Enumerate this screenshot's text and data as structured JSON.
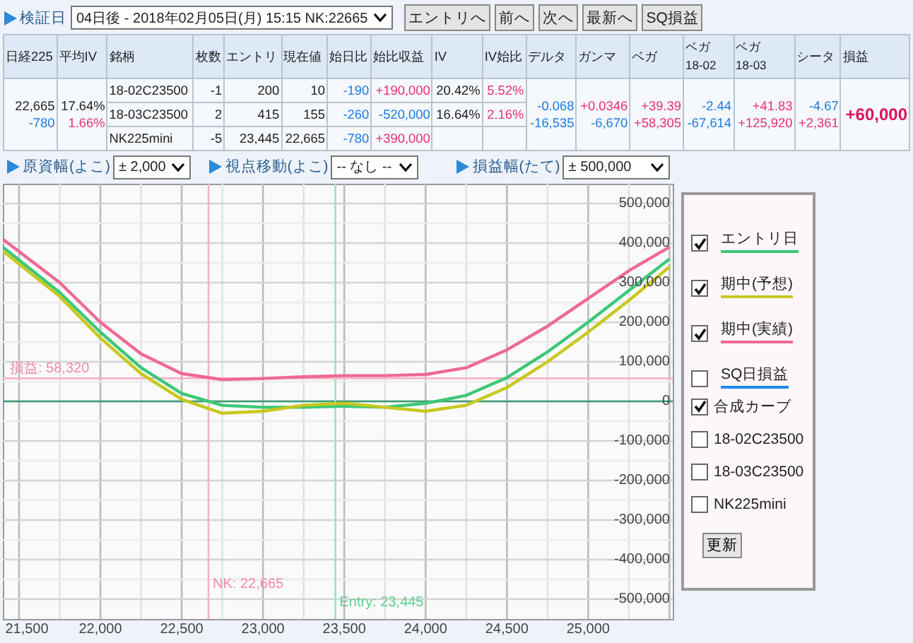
{
  "toolbar": {
    "label": "検証日",
    "date_select": "04日後 - 2018年02月05日(月) 15:15 NK:22665",
    "buttons": [
      "エントリへ",
      "前へ",
      "次へ",
      "最新へ",
      "SQ損益"
    ]
  },
  "table": {
    "columns": [
      {
        "label": "日経225"
      },
      {
        "label": "平均IV"
      },
      {
        "label": "銘柄"
      },
      {
        "label": "枚数"
      },
      {
        "label": "エントリ"
      },
      {
        "label": "現在値"
      },
      {
        "label": "始日比"
      },
      {
        "label": "始比収益"
      },
      {
        "label": "IV"
      },
      {
        "label": "IV始比"
      },
      {
        "label": "デルタ"
      },
      {
        "label": "ガンマ"
      },
      {
        "label": "ベガ"
      },
      {
        "label": "ベガ",
        "sub": "18-02"
      },
      {
        "label": "ベガ",
        "sub": "18-03"
      },
      {
        "label": "シータ"
      },
      {
        "label": "損益"
      }
    ],
    "nikkei": {
      "price": "22,665",
      "change": {
        "text": "-780",
        "color": "#1e7be6"
      }
    },
    "avg_iv": {
      "value": "17.64%",
      "change": {
        "text": "1.66%",
        "color": "#e8307a"
      }
    },
    "rows": [
      {
        "name": "18-02C23500",
        "qty": "-1",
        "entry": "200",
        "current": "10",
        "change": {
          "text": "-190",
          "color": "#1e7be6"
        },
        "pnl": {
          "text": "+190,000",
          "color": "#e8307a"
        },
        "iv": "20.42%",
        "iv_change": {
          "text": "5.52%",
          "color": "#e8307a"
        }
      },
      {
        "name": "18-03C23500",
        "qty": "2",
        "entry": "415",
        "current": "155",
        "change": {
          "text": "-260",
          "color": "#1e7be6"
        },
        "pnl": {
          "text": "-520,000",
          "color": "#1e7be6"
        },
        "iv": "16.64%",
        "iv_change": {
          "text": "2.16%",
          "color": "#e8307a"
        }
      },
      {
        "name": "NK225mini",
        "qty": "-5",
        "entry": "23,445",
        "current": "22,665",
        "change": {
          "text": "-780",
          "color": "#1e7be6"
        },
        "pnl": {
          "text": "+390,000",
          "color": "#e8307a"
        }
      }
    ],
    "greeks": [
      {
        "values": [
          {
            "text": "-0.068",
            "color": "#1e7be6"
          },
          {
            "text": "-16,535",
            "color": "#1e7be6"
          }
        ]
      },
      {
        "values": [
          {
            "text": "+0.0346",
            "color": "#e8307a"
          },
          {
            "text": "-6,670",
            "color": "#1e7be6"
          }
        ]
      },
      {
        "values": [
          {
            "text": "+39.39",
            "color": "#e8307a"
          },
          {
            "text": "+58,305",
            "color": "#e8307a"
          }
        ]
      },
      {
        "values": [
          {
            "text": "-2.44",
            "color": "#1e7be6"
          },
          {
            "text": "-67,614",
            "color": "#1e7be6"
          }
        ]
      },
      {
        "values": [
          {
            "text": "+41.83",
            "color": "#e8307a"
          },
          {
            "text": "+125,920",
            "color": "#e8307a"
          }
        ]
      },
      {
        "values": [
          {
            "text": "-4.67",
            "color": "#1e7be6"
          },
          {
            "text": "+2,361",
            "color": "#e8307a"
          }
        ]
      }
    ],
    "total_pnl": {
      "text": "+60,000",
      "color": "#e0105a"
    }
  },
  "controls": [
    {
      "label": "原資幅(よこ)",
      "value": "± 2,000"
    },
    {
      "label": "視点移動(よこ)",
      "value": "-- なし --"
    },
    {
      "label": "損益幅(たて)",
      "value": "± 500,000"
    }
  ],
  "chart": {
    "chart_data": {
      "type": "line",
      "x": [
        21400,
        21750,
        22000,
        22250,
        22500,
        22750,
        23000,
        23250,
        23500,
        23750,
        24000,
        24250,
        24500,
        24750,
        25000,
        25250,
        25500
      ],
      "series": [
        {
          "color": "#3cc878",
          "values": [
            390000,
            275000,
            175000,
            85000,
            20000,
            -10000,
            -15000,
            -15000,
            -12000,
            -15000,
            -5000,
            15000,
            60000,
            125000,
            200000,
            280000,
            360000
          ]
        },
        {
          "color": "#c8c81e",
          "values": [
            380000,
            265000,
            160000,
            70000,
            5000,
            -30000,
            -25000,
            -10000,
            -5000,
            -15000,
            -25000,
            -10000,
            35000,
            100000,
            175000,
            255000,
            340000
          ]
        },
        {
          "color": "#ee6a93",
          "values": [
            410000,
            300000,
            200000,
            120000,
            70000,
            55000,
            58000,
            62000,
            65000,
            65000,
            68000,
            85000,
            130000,
            190000,
            260000,
            330000,
            390000
          ]
        }
      ],
      "xlim": [
        21400,
        25520
      ],
      "ylim": [
        -550000,
        550000
      ],
      "grid": true,
      "xticks": [
        {
          "value": 21500,
          "label": "21,500"
        },
        {
          "value": 22000,
          "label": "22,000"
        },
        {
          "value": 22500,
          "label": "22,500"
        },
        {
          "value": 23000,
          "label": "23,000"
        },
        {
          "value": 23500,
          "label": "23,500"
        },
        {
          "value": 24000,
          "label": "24,000"
        },
        {
          "value": 24500,
          "label": "24,500"
        },
        {
          "value": 25000,
          "label": "25,000"
        }
      ],
      "yticks": [
        {
          "value": 500000,
          "label": "500,000"
        },
        {
          "value": 400000,
          "label": "400,000"
        },
        {
          "value": 300000,
          "label": "300,000"
        },
        {
          "value": 200000,
          "label": "200,000"
        },
        {
          "value": 100000,
          "label": "100,000"
        },
        {
          "value": 0,
          "label": "0"
        },
        {
          "value": -100000,
          "label": "-100,000"
        },
        {
          "value": -200000,
          "label": "-200,000"
        },
        {
          "value": -300000,
          "label": "-300,000"
        },
        {
          "value": -400000,
          "label": "-400,000"
        },
        {
          "value": -500000,
          "label": "-500,000"
        }
      ],
      "ref_lines": [
        {
          "axis": "y",
          "value": 0,
          "color": "#3a9a72"
        },
        {
          "axis": "y",
          "value": 58320,
          "label": "損益: 58,320",
          "color": "#f4b4c6"
        },
        {
          "axis": "x",
          "value": 22665,
          "label": "NK: 22,665",
          "color": "#f4b4c6"
        },
        {
          "axis": "x",
          "value": 23445,
          "label": "Entry: 23,445",
          "color": "#9ee2bb"
        }
      ]
    }
  },
  "legend": {
    "items": [
      {
        "kind": "line",
        "label": "エントリ日",
        "checked": true,
        "color": "#3cc878"
      },
      {
        "kind": "line",
        "label": "期中(予想)",
        "checked": true,
        "color": "#c8c81e"
      },
      {
        "kind": "line",
        "label": "期中(実績)",
        "checked": true,
        "color": "#ee6a93"
      },
      {
        "kind": "line",
        "label": "SQ日損益",
        "checked": false,
        "color": "#2288ee"
      },
      {
        "kind": "plain",
        "label": "合成カーブ",
        "checked": true
      },
      {
        "kind": "plain",
        "label": "18-02C23500",
        "checked": false
      },
      {
        "kind": "plain",
        "label": "18-03C23500",
        "checked": false
      },
      {
        "kind": "plain",
        "label": "NK225mini",
        "checked": false
      }
    ],
    "button": "更新"
  }
}
